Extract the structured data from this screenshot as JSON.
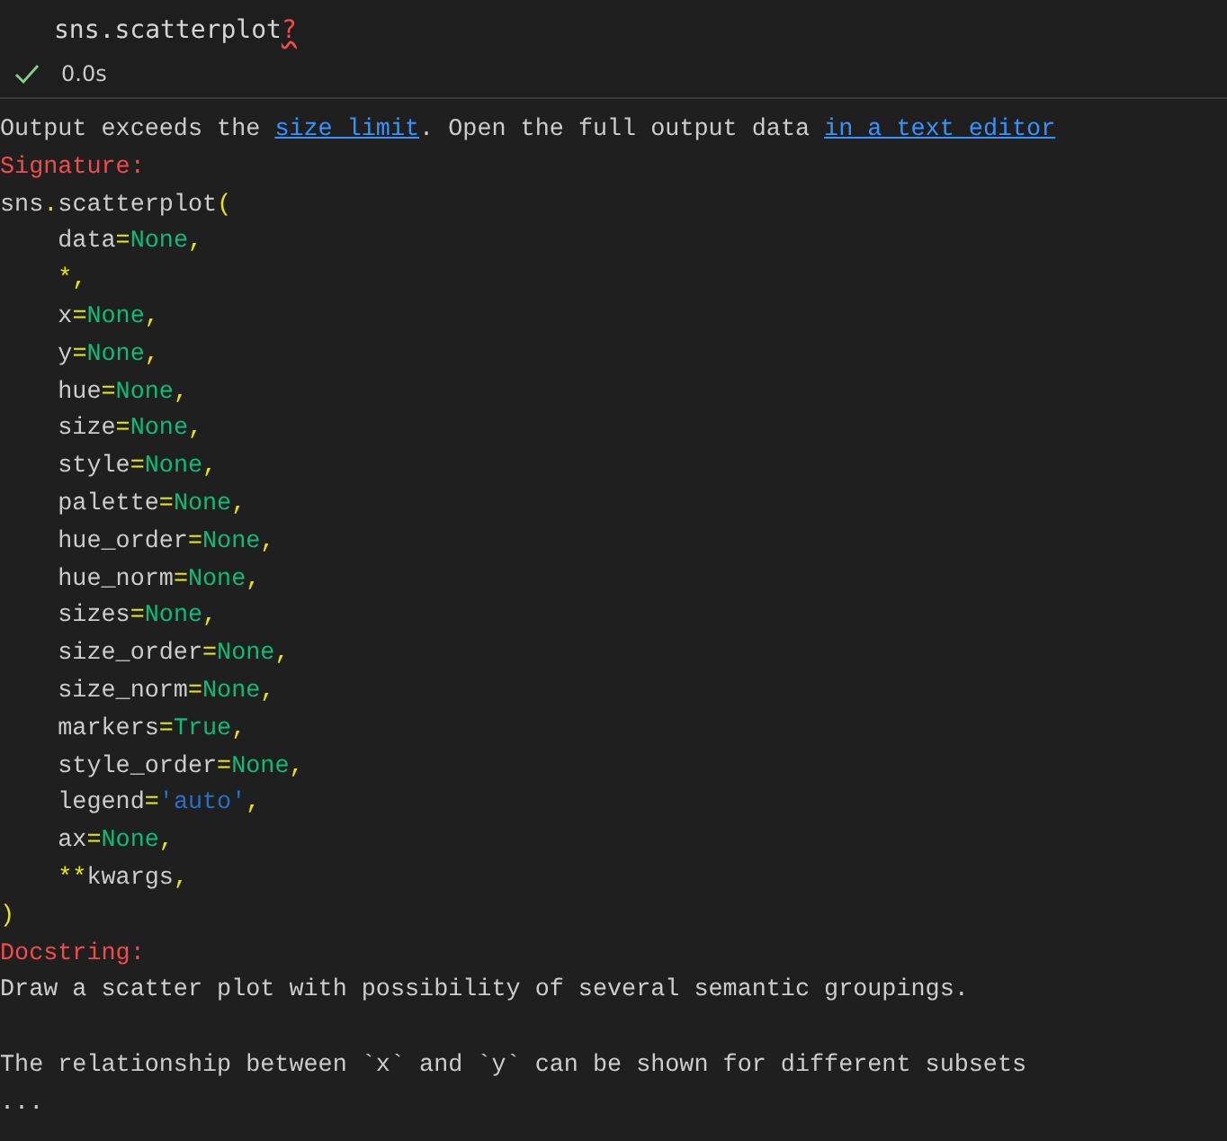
{
  "cell": {
    "source": "sns.scatterplot",
    "error_mark": "?",
    "succeeded": true,
    "duration": "0.0s"
  },
  "output": {
    "notice": [
      {
        "kind": "text",
        "text": "Output exceeds the "
      },
      {
        "kind": "link",
        "text": "size limit"
      },
      {
        "kind": "text",
        "text": ". Open the full output data "
      },
      {
        "kind": "link",
        "text": "in a text editor"
      }
    ],
    "lines": [
      {
        "kind": "code",
        "indented": false,
        "tokens": [
          {
            "kind": "heading",
            "text": "Signature:"
          }
        ]
      },
      {
        "kind": "code",
        "indented": false,
        "tokens": [
          {
            "kind": "plain",
            "text": "sns"
          },
          {
            "kind": "punct",
            "text": "."
          },
          {
            "kind": "plain",
            "text": "scatterplot"
          },
          {
            "kind": "punct",
            "text": "("
          }
        ]
      },
      {
        "kind": "code",
        "indented": true,
        "tokens": [
          {
            "kind": "plain",
            "text": "data"
          },
          {
            "kind": "punct",
            "text": "="
          },
          {
            "kind": "constant",
            "text": "None"
          },
          {
            "kind": "punct",
            "text": ","
          }
        ]
      },
      {
        "kind": "code",
        "indented": true,
        "tokens": [
          {
            "kind": "punct",
            "text": "*,"
          }
        ]
      },
      {
        "kind": "code",
        "indented": true,
        "tokens": [
          {
            "kind": "plain",
            "text": "x"
          },
          {
            "kind": "punct",
            "text": "="
          },
          {
            "kind": "constant",
            "text": "None"
          },
          {
            "kind": "punct",
            "text": ","
          }
        ]
      },
      {
        "kind": "code",
        "indented": true,
        "tokens": [
          {
            "kind": "plain",
            "text": "y"
          },
          {
            "kind": "punct",
            "text": "="
          },
          {
            "kind": "constant",
            "text": "None"
          },
          {
            "kind": "punct",
            "text": ","
          }
        ]
      },
      {
        "kind": "code",
        "indented": true,
        "tokens": [
          {
            "kind": "plain",
            "text": "hue"
          },
          {
            "kind": "punct",
            "text": "="
          },
          {
            "kind": "constant",
            "text": "None"
          },
          {
            "kind": "punct",
            "text": ","
          }
        ]
      },
      {
        "kind": "code",
        "indented": true,
        "tokens": [
          {
            "kind": "plain",
            "text": "size"
          },
          {
            "kind": "punct",
            "text": "="
          },
          {
            "kind": "constant",
            "text": "None"
          },
          {
            "kind": "punct",
            "text": ","
          }
        ]
      },
      {
        "kind": "code",
        "indented": true,
        "tokens": [
          {
            "kind": "plain",
            "text": "style"
          },
          {
            "kind": "punct",
            "text": "="
          },
          {
            "kind": "constant",
            "text": "None"
          },
          {
            "kind": "punct",
            "text": ","
          }
        ]
      },
      {
        "kind": "code",
        "indented": true,
        "tokens": [
          {
            "kind": "plain",
            "text": "palette"
          },
          {
            "kind": "punct",
            "text": "="
          },
          {
            "kind": "constant",
            "text": "None"
          },
          {
            "kind": "punct",
            "text": ","
          }
        ]
      },
      {
        "kind": "code",
        "indented": true,
        "tokens": [
          {
            "kind": "plain",
            "text": "hue_order"
          },
          {
            "kind": "punct",
            "text": "="
          },
          {
            "kind": "constant",
            "text": "None"
          },
          {
            "kind": "punct",
            "text": ","
          }
        ]
      },
      {
        "kind": "code",
        "indented": true,
        "tokens": [
          {
            "kind": "plain",
            "text": "hue_norm"
          },
          {
            "kind": "punct",
            "text": "="
          },
          {
            "kind": "constant",
            "text": "None"
          },
          {
            "kind": "punct",
            "text": ","
          }
        ]
      },
      {
        "kind": "code",
        "indented": true,
        "tokens": [
          {
            "kind": "plain",
            "text": "sizes"
          },
          {
            "kind": "punct",
            "text": "="
          },
          {
            "kind": "constant",
            "text": "None"
          },
          {
            "kind": "punct",
            "text": ","
          }
        ]
      },
      {
        "kind": "code",
        "indented": true,
        "tokens": [
          {
            "kind": "plain",
            "text": "size_order"
          },
          {
            "kind": "punct",
            "text": "="
          },
          {
            "kind": "constant",
            "text": "None"
          },
          {
            "kind": "punct",
            "text": ","
          }
        ]
      },
      {
        "kind": "code",
        "indented": true,
        "tokens": [
          {
            "kind": "plain",
            "text": "size_norm"
          },
          {
            "kind": "punct",
            "text": "="
          },
          {
            "kind": "constant",
            "text": "None"
          },
          {
            "kind": "punct",
            "text": ","
          }
        ]
      },
      {
        "kind": "code",
        "indented": true,
        "tokens": [
          {
            "kind": "plain",
            "text": "markers"
          },
          {
            "kind": "punct",
            "text": "="
          },
          {
            "kind": "constant",
            "text": "True"
          },
          {
            "kind": "punct",
            "text": ","
          }
        ]
      },
      {
        "kind": "code",
        "indented": true,
        "tokens": [
          {
            "kind": "plain",
            "text": "style_order"
          },
          {
            "kind": "punct",
            "text": "="
          },
          {
            "kind": "constant",
            "text": "None"
          },
          {
            "kind": "punct",
            "text": ","
          }
        ]
      },
      {
        "kind": "code",
        "indented": true,
        "tokens": [
          {
            "kind": "plain",
            "text": "legend"
          },
          {
            "kind": "punct",
            "text": "="
          },
          {
            "kind": "string",
            "text": "'auto'"
          },
          {
            "kind": "punct",
            "text": ","
          }
        ]
      },
      {
        "kind": "code",
        "indented": true,
        "tokens": [
          {
            "kind": "plain",
            "text": "ax"
          },
          {
            "kind": "punct",
            "text": "="
          },
          {
            "kind": "constant",
            "text": "None"
          },
          {
            "kind": "punct",
            "text": ","
          }
        ]
      },
      {
        "kind": "code",
        "indented": true,
        "tokens": [
          {
            "kind": "punct",
            "text": "**"
          },
          {
            "kind": "plain",
            "text": "kwargs"
          },
          {
            "kind": "punct",
            "text": ","
          }
        ]
      },
      {
        "kind": "code",
        "indented": false,
        "tokens": [
          {
            "kind": "punct",
            "text": ")"
          }
        ]
      },
      {
        "kind": "code",
        "indented": false,
        "tokens": [
          {
            "kind": "heading",
            "text": "Docstring:"
          }
        ]
      },
      {
        "kind": "code",
        "indented": false,
        "tokens": [
          {
            "kind": "plain",
            "text": "Draw a scatter plot with possibility of several semantic groupings."
          }
        ]
      },
      {
        "kind": "blank"
      },
      {
        "kind": "code",
        "indented": false,
        "tokens": [
          {
            "kind": "plain",
            "text": "The relationship between `x` and `y` can be shown for different subsets"
          }
        ]
      },
      {
        "kind": "code",
        "indented": false,
        "tokens": [
          {
            "kind": "plain",
            "text": "..."
          }
        ]
      }
    ]
  }
}
